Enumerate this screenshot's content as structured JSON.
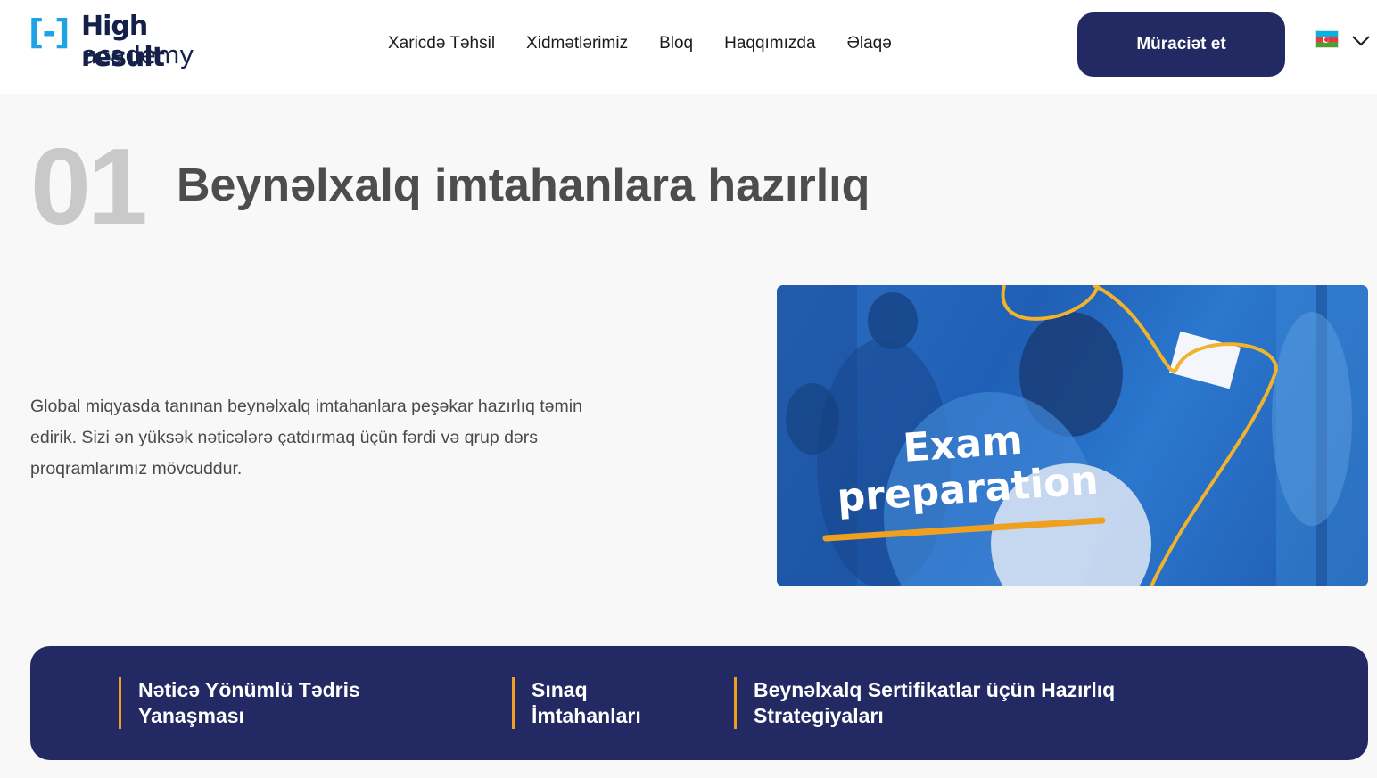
{
  "header": {
    "logo": {
      "mark": "[-]",
      "line1": "High result",
      "line2": "academy"
    },
    "nav": [
      {
        "label": "Xaricdə Təhsil"
      },
      {
        "label": "Xidmətlərimiz"
      },
      {
        "label": "Bloq"
      },
      {
        "label": "Haqqımızda"
      },
      {
        "label": "Əlaqə"
      }
    ],
    "apply_label": "Müraciət et",
    "language": {
      "flag": "azerbaijan-flag-icon",
      "icon": "chevron-down-icon"
    }
  },
  "section": {
    "number": "01",
    "title": "Beynəlxalq imtahanlara hazırlıq",
    "description": "Global miqyasda tanınan beynəlxalq imtahanlara peşəkar hazırlıq təmin edirik. Sizi ən yüksək nəticələrə çatdırmaq üçün fərdi və qrup dərs proqramlarımız mövcuddur.",
    "image": {
      "line1": "Exam",
      "line2": "preparation"
    }
  },
  "features": [
    {
      "label": "Nəticə Yönümlü Tədris Yanaşması"
    },
    {
      "label": "Sınaq İmtahanları"
    },
    {
      "label": "Beynəlxalq Sertifikatlar üçün Hazırlıq Strategiyaları"
    }
  ],
  "colors": {
    "brand_navy": "#232a63",
    "logo_blue": "#1ea4e6",
    "accent_orange": "#f0a020",
    "number_gray": "#c9c9c9"
  }
}
